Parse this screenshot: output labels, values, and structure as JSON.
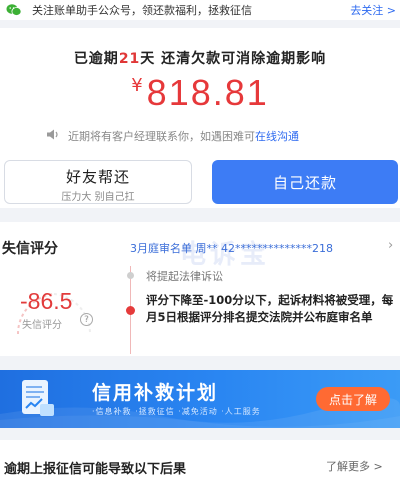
{
  "notice": {
    "text": "关注账单助手公众号，领还款福利，拯救征信",
    "link": "去关注 >"
  },
  "overdue": {
    "prefix": "已逾期",
    "days": "21",
    "suffix": "天 还清欠款可消除逾期影响",
    "currency": "¥",
    "amount": "818.81",
    "manager_text": "近期将有客户经理联系你，如遇困难可",
    "manager_link": "在线沟通"
  },
  "buttons": {
    "friend_main": "好友帮还",
    "friend_sub": "压力大 别自己扛",
    "self": "自己还款"
  },
  "credit": {
    "title": "失信评分",
    "list_info": "3月庭审名单 周** 42**************218",
    "watermark": "电诉宝",
    "score": "-86.5",
    "score_label": "失信评分",
    "question": "?",
    "step_lawsuit": "将提起法律诉讼",
    "step_desc": "评分下降至-100分以下，起诉材料将被受理，每月5日根据评分排名提交法院并公布庭审名单"
  },
  "banner": {
    "title": "信用补救计划",
    "tags": "·信息补救  ·拯救征信  ·减免活动  ·人工服务",
    "button": "点击了解"
  },
  "bottom": {
    "title": "逾期上报征信可能导致以下后果",
    "more": "了解更多 >"
  },
  "colors": {
    "accent_red": "#e6383a",
    "accent_blue": "#3d7cf5",
    "banner_button": "#ff6a33",
    "wechat_green": "#3cb035"
  }
}
